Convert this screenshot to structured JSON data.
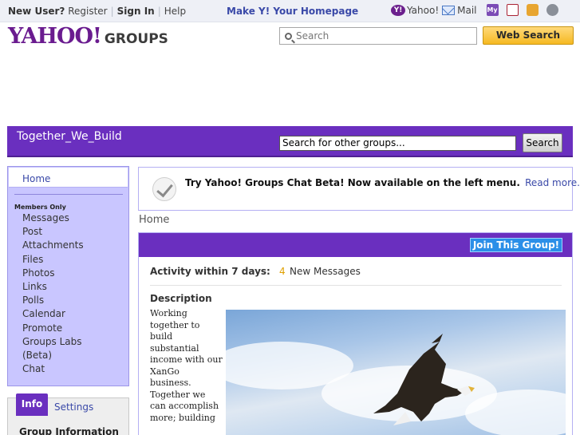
{
  "topbar": {
    "new_user": "New User?",
    "register": "Register",
    "sign_in": "Sign In",
    "help": "Help",
    "homepage": "Make Y! Your Homepage",
    "yahoo": "Yahoo!",
    "mail": "Mail",
    "my_icon": "My",
    "icons": [
      "yahoo-badge-icon",
      "mail-icon",
      "my-yahoo-icon",
      "calendar-icon",
      "puzzle-icon",
      "settings-icon"
    ]
  },
  "header": {
    "logo_text": "YAHOO!",
    "logo_groups": "GROUPS",
    "search_placeholder": "Search",
    "web_search": "Web Search",
    "brand_color": "#6a1b8f",
    "accent_color": "#f5b922"
  },
  "group": {
    "name": "Together_We_Build",
    "search_value": "Search for other groups...",
    "search_button": "Search",
    "bar_color": "#6a2fbf"
  },
  "sidebar": {
    "home": "Home",
    "members_only": "Members Only",
    "items": [
      "Messages",
      "Post",
      "Attachments",
      "Files",
      "Photos",
      "Links",
      "Polls",
      "Calendar",
      "Promote",
      "Groups Labs",
      "(Beta)",
      "Chat"
    ]
  },
  "infobox": {
    "tab_info": "Info",
    "tab_settings": "Settings",
    "title": "Group Information"
  },
  "notice": {
    "message": "Try Yahoo! Groups Chat Beta! Now available on the left menu.",
    "read_more": "Read more..."
  },
  "breadcrumb": "Home",
  "main": {
    "join_button": "Join This Group!",
    "activity_label": "Activity within 7 days:",
    "activity_count": "4",
    "activity_text": "New Messages",
    "description_label": "Description",
    "description_text": "Working together to build substantial income with our XanGo business. Together we can accomplish more; building"
  }
}
